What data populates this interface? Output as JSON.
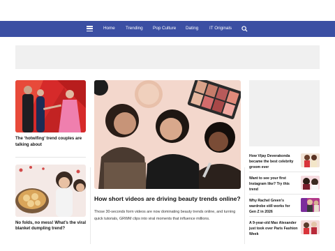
{
  "nav": {
    "items": [
      "Home",
      "Trending",
      "Pop Culture",
      "Dating",
      "IT Originals"
    ]
  },
  "left_cards": [
    {
      "title": "The ‘hotwifing’ trend couples are talking about"
    },
    {
      "title": "No folds, no mess! What’s the viral blanket dumpling trend?"
    }
  ],
  "feature": {
    "title": "How short videos are driving beauty trends online?",
    "description": "Those 30-seconds form videos are now dominating beauty trends online, and turning quick tutorials, GRWM clips into viral moments that influence millions."
  },
  "right_items": [
    {
      "title": "How Vijay Deverakonda became the best celebrity groom ever"
    },
    {
      "title": "Want to see your first Instagram like? Try this trend"
    },
    {
      "title": "Why Rachel Green’s wardrobe still works for Gen Z in 2026"
    },
    {
      "title": "A 9-year-old Max Alexander just took over Paris Fashion Week"
    }
  ],
  "colors": {
    "nav_bg": "#3b4fa3",
    "ad_bg": "#f0f0f0"
  }
}
